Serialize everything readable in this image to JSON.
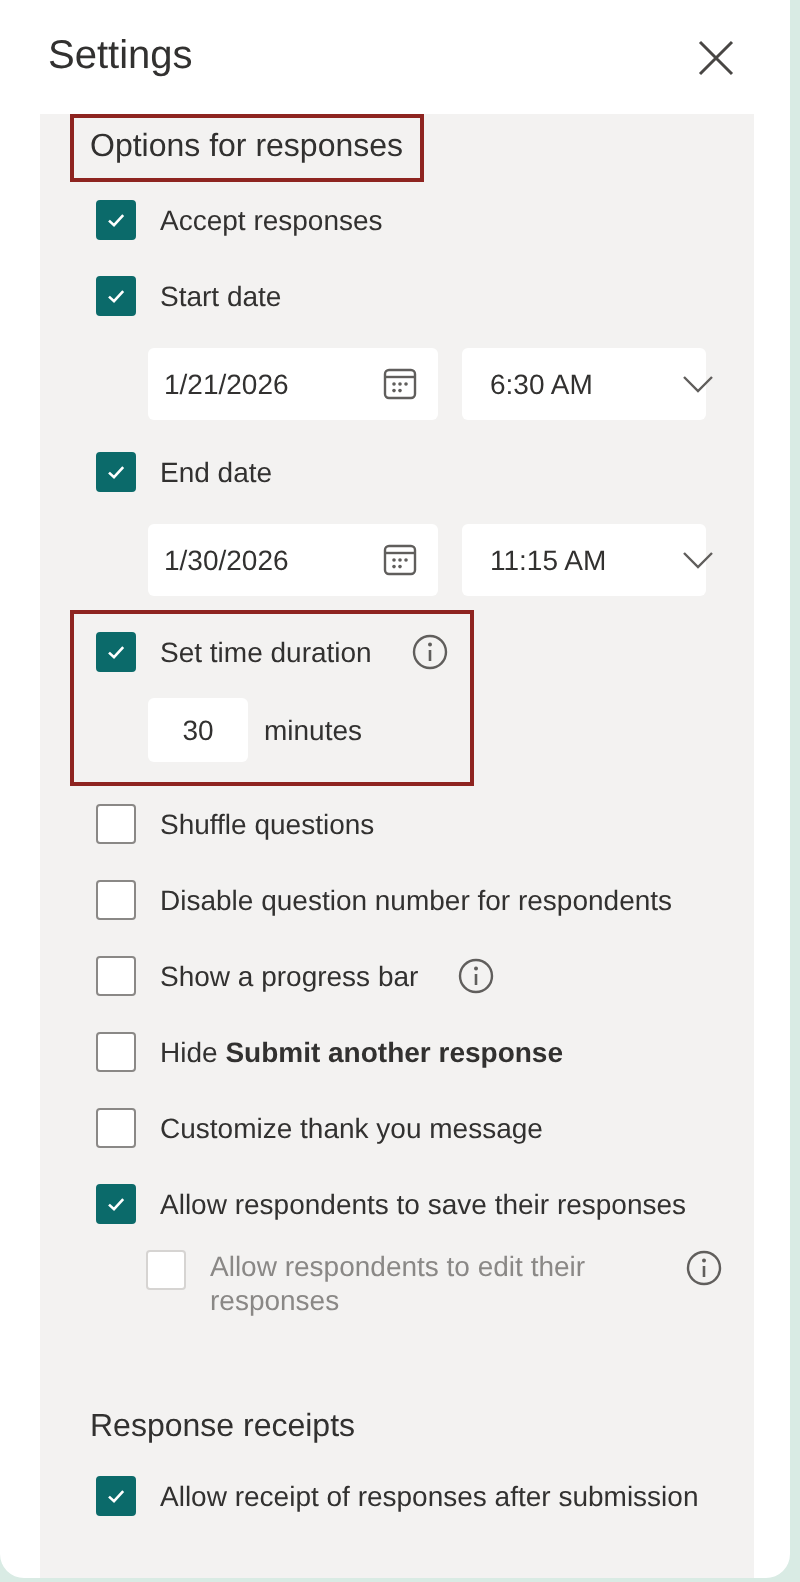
{
  "window": {
    "title": "Settings"
  },
  "sections": [
    {
      "title": "Options for responses",
      "highlighted": true,
      "options": [
        {
          "kind": "checkbox",
          "label": "Accept responses",
          "checked": true
        },
        {
          "kind": "datetime",
          "label": "Start date",
          "checked": true,
          "date": "1/21/2026",
          "time": "6:30 AM"
        },
        {
          "kind": "datetime",
          "label": "End date",
          "checked": true,
          "date": "1/30/2026",
          "time": "11:15 AM"
        },
        {
          "kind": "duration",
          "label": "Set time duration",
          "checked": true,
          "info": true,
          "highlighted": true,
          "duration": "30",
          "unit": "minutes"
        },
        {
          "kind": "checkbox",
          "label": "Shuffle questions",
          "checked": false
        },
        {
          "kind": "checkbox",
          "label": "Disable question number for respondents",
          "checked": false
        },
        {
          "kind": "checkbox",
          "label": "Show a progress bar",
          "checked": false,
          "info": true
        },
        {
          "kind": "checkbox",
          "label": "Hide **Submit another response**",
          "checked": false
        },
        {
          "kind": "checkbox",
          "label": "Customize thank you message",
          "checked": false
        },
        {
          "kind": "checkbox",
          "label": "Allow respondents to save their responses",
          "checked": true,
          "children": [
            {
              "kind": "checkbox",
              "label": "Allow respondents to edit their responses",
              "checked": false,
              "disabled": true,
              "info": true
            }
          ]
        }
      ]
    },
    {
      "title": "Response receipts",
      "highlighted": false,
      "options": [
        {
          "kind": "checkbox",
          "label": "Allow receipt of responses after submission",
          "checked": true
        }
      ]
    }
  ]
}
